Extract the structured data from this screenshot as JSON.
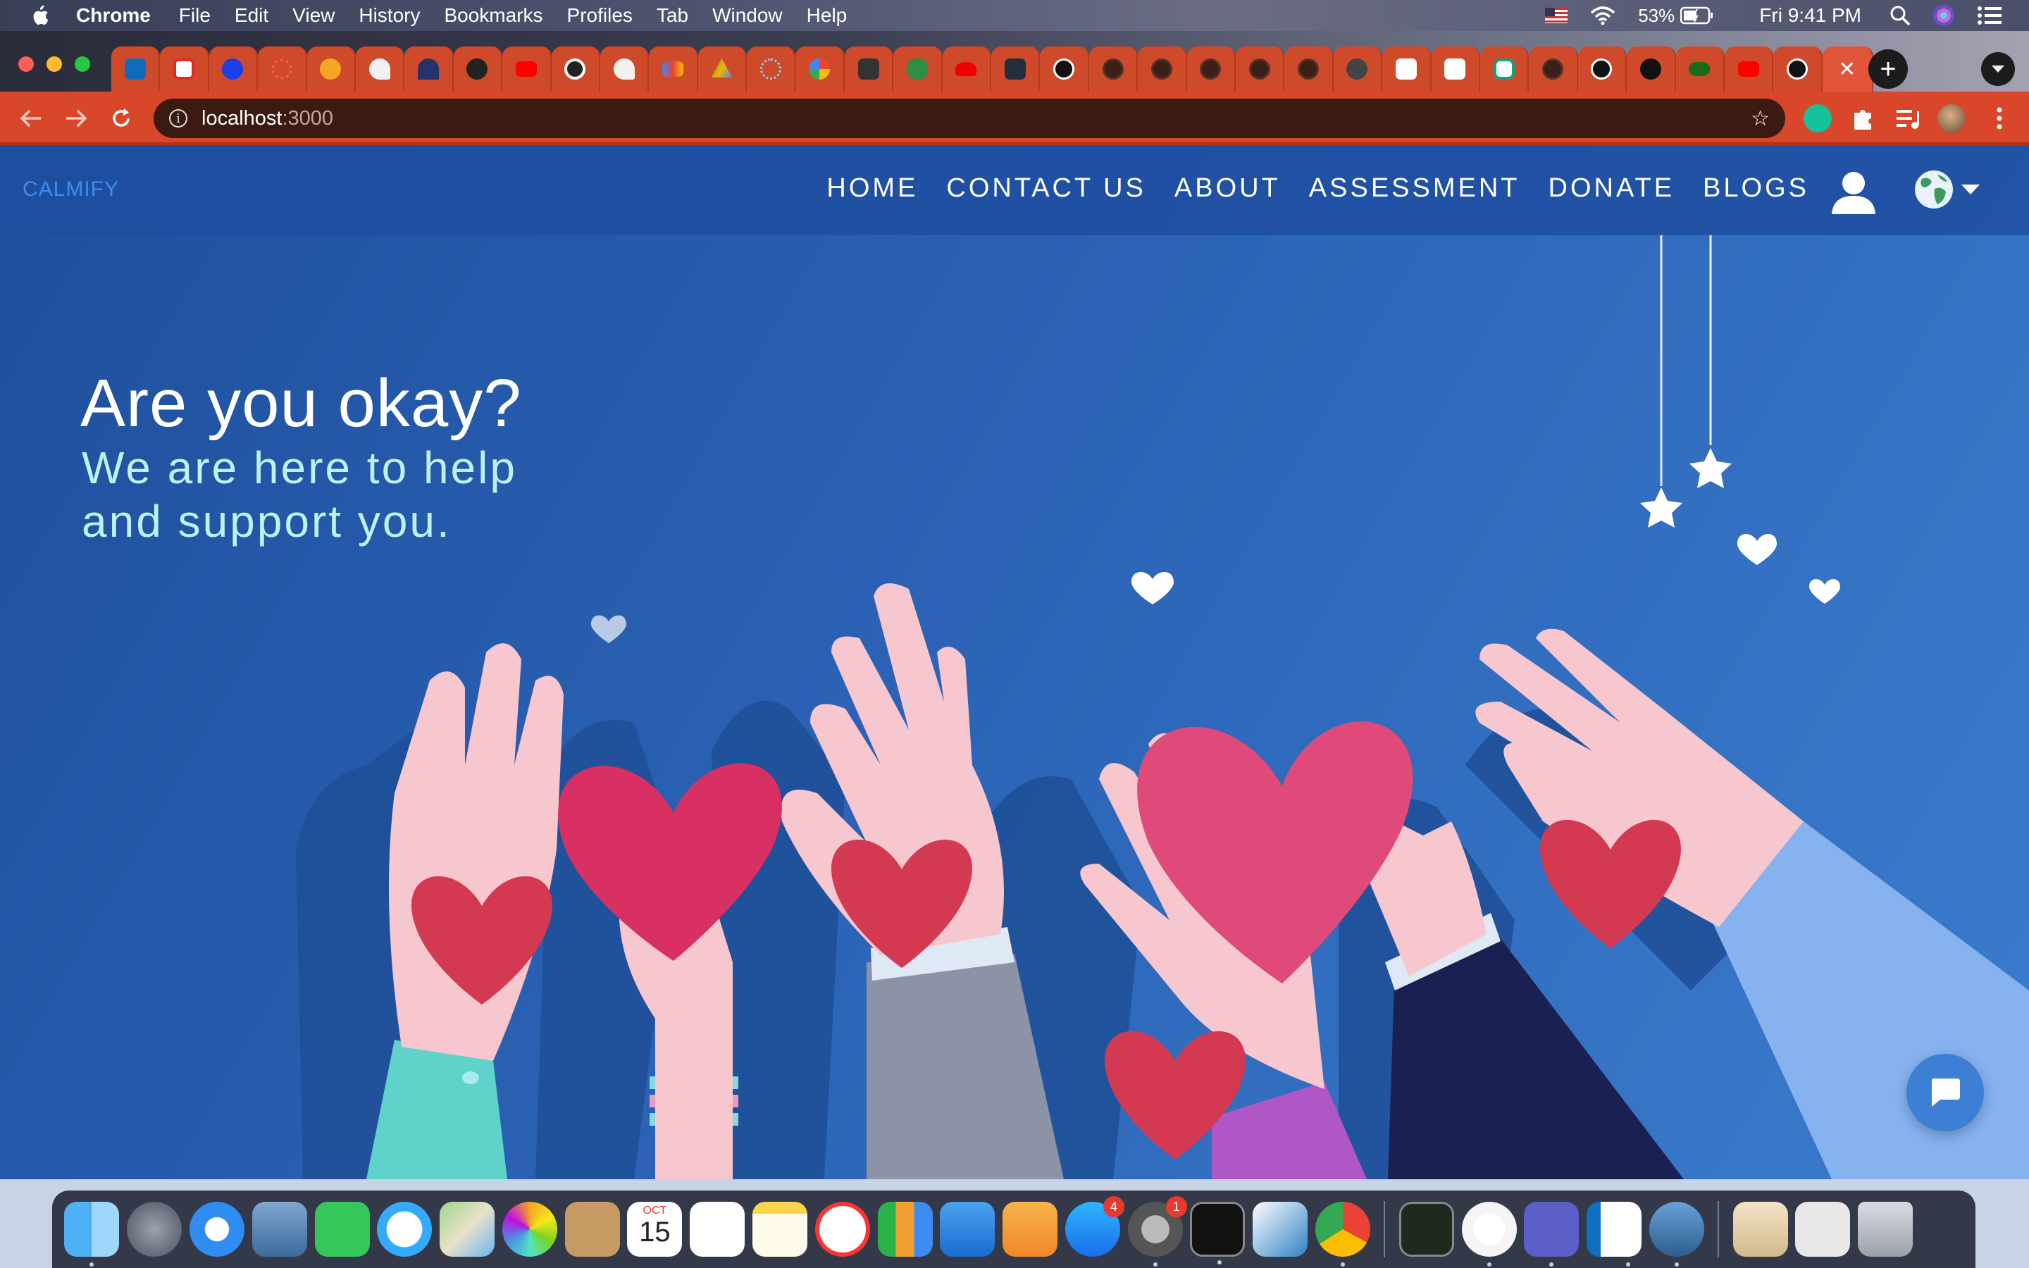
{
  "menubar": {
    "app_name": "Chrome",
    "menus": [
      "File",
      "Edit",
      "View",
      "History",
      "Bookmarks",
      "Profiles",
      "Tab",
      "Window",
      "Help"
    ],
    "battery": "53%",
    "clock": "Fri 9:41 PM"
  },
  "browser": {
    "url_host": "localhost",
    "url_port": ":3000",
    "new_tab_label": "+",
    "close_tab_label": "✕"
  },
  "site": {
    "brand": "CALMIFY",
    "nav": [
      "HOME",
      "CONTACT US",
      "ABOUT",
      "ASSESSMENT",
      "DONATE",
      "BLOGS"
    ],
    "hero_title": "Are you okay?",
    "hero_subtitle": "We are here to help and support you."
  },
  "dock": {
    "calendar_month": "OCT",
    "calendar_day": "15",
    "app_store_badge": "4",
    "settings_badge": "1"
  },
  "colors": {
    "page_blue": "#2b62b5",
    "brand": "#3d8cf2",
    "subtitle": "#bdf1f4",
    "heart": "#d33a52",
    "chrome_tab": "#ce4a2b"
  }
}
